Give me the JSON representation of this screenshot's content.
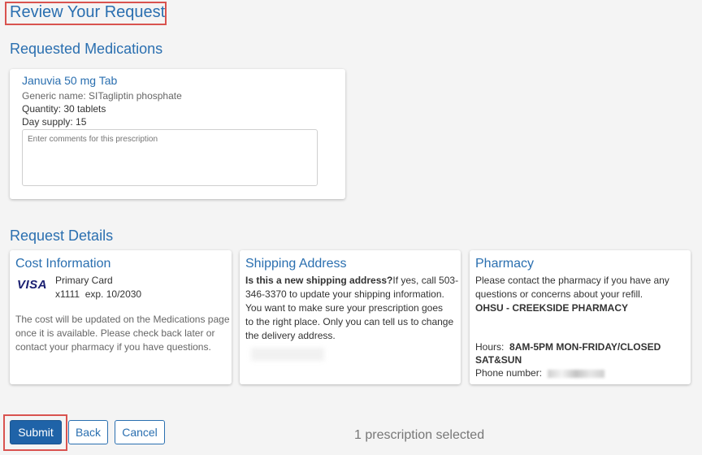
{
  "page": {
    "title": "Review Your Request"
  },
  "medications": {
    "heading": "Requested Medications",
    "items": [
      {
        "name": "Januvia 50 mg Tab",
        "generic": "Generic name: SITagliptin phosphate",
        "quantity": "Quantity: 30 tablets",
        "day_supply": "Day supply: 15",
        "comments_placeholder": "Enter comments for this prescription"
      }
    ]
  },
  "details": {
    "heading": "Request Details",
    "cost": {
      "title": "Cost Information",
      "card_brand": "VISA",
      "card_name": "Primary Card",
      "card_number": "x1111",
      "card_exp": "exp. 10/2030",
      "note_1": "The cost will be updated on the Medications page",
      "note_2": "once it is available. Please check back later or",
      "note_3": "contact your pharmacy if you have questions."
    },
    "shipping": {
      "title": "Shipping Address",
      "question": "Is this a new shipping address?",
      "line_1_rest": "If yes, call 503-",
      "line_2": "346-3370 to update your shipping information.",
      "line_3": "You want to make sure your prescription goes",
      "line_4": "to the right place. Only you can tell us to change",
      "line_5": "the delivery address."
    },
    "pharmacy": {
      "title": "Pharmacy",
      "line_1": "Please contact the pharmacy if you have any",
      "line_2": "questions or concerns about your refill.",
      "name": "OHSU - CREEKSIDE PHARMACY",
      "hours_label": "Hours:",
      "hours_1": "8AM-5PM MON-FRIDAY/CLOSED",
      "hours_2": "SAT&SUN",
      "phone_label": "Phone number:"
    }
  },
  "actions": {
    "submit": "Submit",
    "back": "Back",
    "cancel": "Cancel",
    "selected_count": "1 prescription selected"
  }
}
